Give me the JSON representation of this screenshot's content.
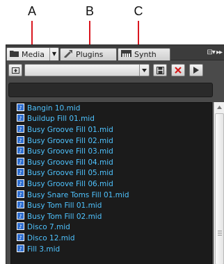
{
  "callouts": [
    "A",
    "B",
    "C"
  ],
  "tabs": [
    {
      "label": "Media",
      "icon": "folder-icon"
    },
    {
      "label": "Plugins",
      "icon": "plugin-icon"
    },
    {
      "label": "Synth",
      "icon": "synth-icon"
    }
  ],
  "toolbar": {
    "path_value": "",
    "icons": [
      "up-folder-icon",
      "save-icon",
      "delete-icon",
      "play-icon"
    ]
  },
  "search": {
    "value": ""
  },
  "files": [
    "Bangin 10.mid",
    "Buildup Fill 01.mid",
    "Busy Groove Fill 01.mid",
    "Busy Groove Fill 02.mid",
    "Busy Groove Fill 03.mid",
    "Busy Groove Fill 04.mid",
    "Busy Groove Fill 05.mid",
    "Busy Groove Fill 06.mid",
    "Busy Snare Toms Fill 01.mid",
    "Busy Tom Fill 01.mid",
    "Busy Tom Fill 02.mid",
    "Disco 7.mid",
    "Disco 12.mid",
    "Fill 3.mid"
  ],
  "colors": {
    "callout_line": "#d9161f",
    "file_text": "#4fc3ff",
    "list_bg": "#1b1b1b",
    "panel_bg": "#4a4a4a",
    "delete_red": "#d61a1a"
  }
}
